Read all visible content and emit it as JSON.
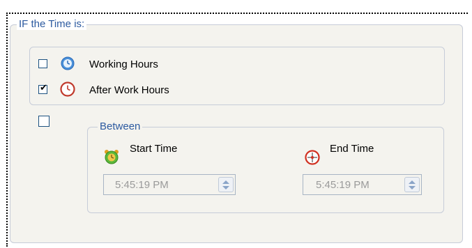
{
  "group_if_time": {
    "legend": "IF the Time is:"
  },
  "options": {
    "working_hours": {
      "label": "Working Hours",
      "checked": false,
      "icon": "clock-blue-icon"
    },
    "after_work_hours": {
      "label": "After Work Hours",
      "checked": true,
      "icon": "clock-red-icon"
    }
  },
  "between": {
    "enable_checked": false,
    "legend": "Between",
    "start": {
      "label": "Start Time",
      "value": "5:45:19 PM",
      "icon": "alarm-clock-green-icon"
    },
    "end": {
      "label": "End Time",
      "value": "5:45:19 PM",
      "icon": "timer-red-icon"
    }
  },
  "colors": {
    "legend_text": "#2c5aa0",
    "group_border": "#c6ccd8",
    "disabled_text": "#9a9a9a",
    "panel_bg": "#f4f3ee"
  }
}
